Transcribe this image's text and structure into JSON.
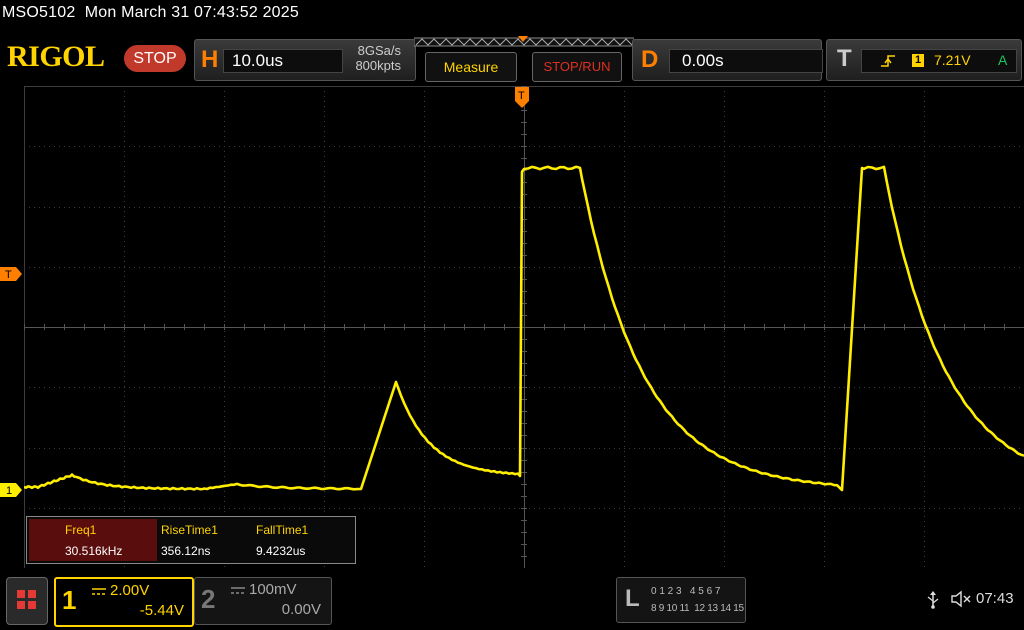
{
  "header": {
    "model": "MSO5102",
    "datetime": "Mon March 31 07:43:52 2025",
    "logo": "RIGOL",
    "run_state": "STOP"
  },
  "horizontal": {
    "letter": "H",
    "timebase": "10.0us",
    "sample_rate": "8GSa/s",
    "memory_depth": "800kpts"
  },
  "buttons": {
    "measure": "Measure",
    "stop_run": "STOP/RUN"
  },
  "delay": {
    "letter": "D",
    "value": "0.00s"
  },
  "trigger": {
    "letter": "T",
    "channel": "1",
    "level": "7.21V",
    "mode": "A",
    "marker": "T",
    "top_marker": "T"
  },
  "channel1_marker": "1",
  "measurements": {
    "headers": [
      "Freq1",
      "RiseTime1",
      "FallTime1"
    ],
    "values": [
      "30.516kHz",
      "356.12ns",
      "9.4232us"
    ]
  },
  "channels": {
    "ch1": {
      "num": "1",
      "scale": "2.00V",
      "offset": "-5.44V"
    },
    "ch2": {
      "num": "2",
      "scale": "100mV",
      "offset": "0.00V"
    }
  },
  "logic": {
    "letter": "L",
    "row1": "0 1 2 3   4 5 6 7",
    "row2": "8 9 10 11  12 13 14 15"
  },
  "status": {
    "clock": "07:43"
  },
  "colors": {
    "trace": "#ffee00",
    "accent": "#ff7f00",
    "grid": "#3c3c3c"
  }
}
